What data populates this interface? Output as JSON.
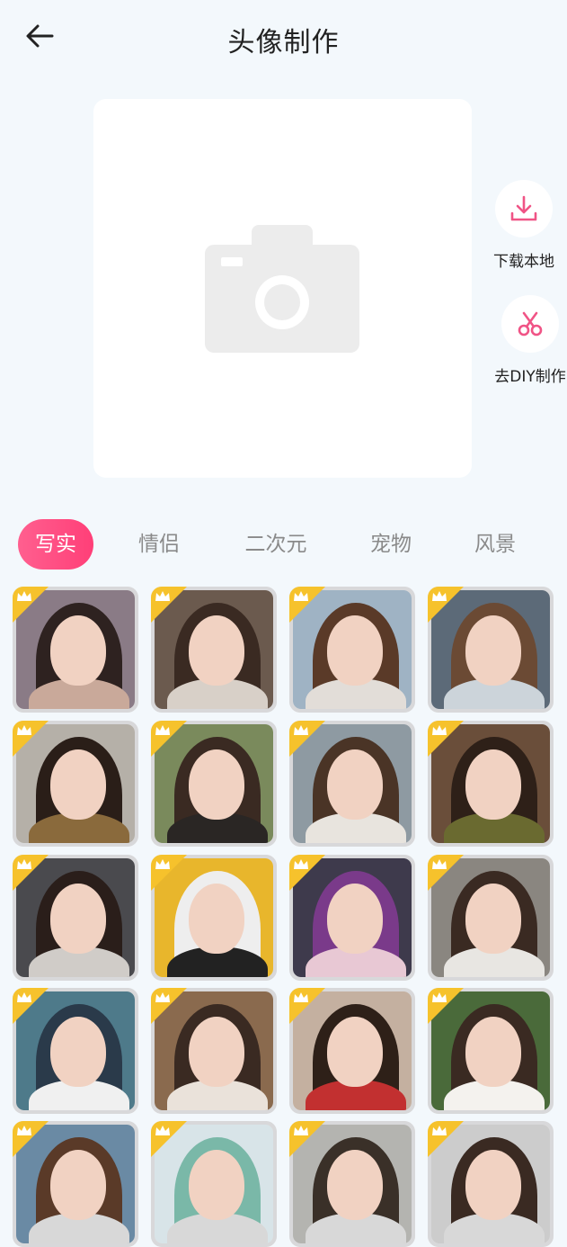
{
  "header": {
    "title": "头像制作"
  },
  "actions": [
    {
      "label": "下载本地",
      "icon": "download-icon"
    },
    {
      "label": "去DIY制作",
      "icon": "scissors-icon"
    }
  ],
  "tabs": [
    {
      "label": "写实",
      "active": true
    },
    {
      "label": "情侣",
      "active": false
    },
    {
      "label": "二次元",
      "active": false
    },
    {
      "label": "宠物",
      "active": false
    },
    {
      "label": "风景",
      "active": false
    }
  ],
  "colors": {
    "accent": "#ff4b7f",
    "badge": "#f6c22c",
    "background": "#f3f8fc"
  },
  "gallery": {
    "items": [
      {
        "bg": "#8a7b86",
        "hair": "#2e2220",
        "body": "#c9a99a"
      },
      {
        "bg": "#6b5a4e",
        "hair": "#3a2a22",
        "body": "#d8d0c8"
      },
      {
        "bg": "#9fb3c4",
        "hair": "#5a3a28",
        "body": "#e2ddd8"
      },
      {
        "bg": "#5c6a78",
        "hair": "#6b4a34",
        "body": "#ccd4da"
      },
      {
        "bg": "#b5b0a8",
        "hair": "#2a1e18",
        "body": "#8a6a3c"
      },
      {
        "bg": "#7a8a5c",
        "hair": "#3a2a22",
        "body": "#2a2624"
      },
      {
        "bg": "#8e9aa2",
        "hair": "#4a3426",
        "body": "#e8e4de"
      },
      {
        "bg": "#6a4e3a",
        "hair": "#2e2018",
        "body": "#6a6a30"
      },
      {
        "bg": "#4a4a4e",
        "hair": "#2a1e1a",
        "body": "#d0ccc8"
      },
      {
        "bg": "#e8b62c",
        "hair": "#eeeeee",
        "body": "#222222"
      },
      {
        "bg": "#3e3a4c",
        "hair": "#7a3a8a",
        "body": "#e8c8d4"
      },
      {
        "bg": "#8a8680",
        "hair": "#3a2a22",
        "body": "#e8e6e2"
      },
      {
        "bg": "#4e7a8a",
        "hair": "#2a3a4a",
        "body": "#f0f0f0"
      },
      {
        "bg": "#8a6a4e",
        "hair": "#3a2a22",
        "body": "#eae2da"
      },
      {
        "bg": "#c4b0a0",
        "hair": "#2e2018",
        "body": "#c23030"
      },
      {
        "bg": "#4a6a3a",
        "hair": "#3a2a22",
        "body": "#f4f2ee"
      },
      {
        "bg": "#6a8aa4",
        "hair": "#5a3a28",
        "body": "#d8d8d8"
      },
      {
        "bg": "#d8e4e8",
        "hair": "#7ab8a8",
        "body": "#d8d8d8"
      },
      {
        "bg": "#b4b4b0",
        "hair": "#3a3028",
        "body": "#d8d8d8"
      },
      {
        "bg": "#cccccc",
        "hair": "#3a2a22",
        "body": "#d8d8d8"
      }
    ]
  }
}
